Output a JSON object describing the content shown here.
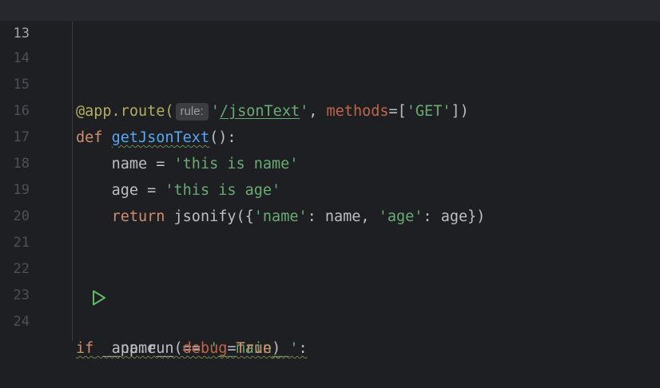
{
  "editor": {
    "lines": [
      {
        "number": "13"
      },
      {
        "number": "14"
      },
      {
        "number": "15",
        "decorator": "@app.route(",
        "hint": "rule:",
        "route": "'/jsonText'",
        "sep": ", ",
        "kwarg": "methods",
        "eq": "=",
        "lb": "[",
        "method": "'GET'",
        "close": "])"
      },
      {
        "number": "16",
        "def": "def ",
        "fname": "getJsonText",
        "rest": "():"
      },
      {
        "number": "17",
        "indent": "    ",
        "var": "name = ",
        "value": "'this is name'"
      },
      {
        "number": "18",
        "indent": "    ",
        "var": "age = ",
        "value": "'this is age'"
      },
      {
        "number": "19",
        "indent": "    ",
        "ret": "return",
        "call": " jsonify({",
        "k1": "'name'",
        "p1": ": name, ",
        "k2": "'age'",
        "p2": ": age})"
      },
      {
        "number": "20"
      },
      {
        "number": "21"
      },
      {
        "number": "22"
      },
      {
        "number": "23",
        "if": "if",
        "cond": " __name__ == ",
        "main": "'__main__'",
        "colon": ":"
      },
      {
        "number": "24",
        "indent": "    ",
        "call": "app.run(",
        "kwarg": "debug",
        "eq": "=",
        "val": "True",
        "close": ")"
      }
    ],
    "run_icon": "run-triangle-icon",
    "colors": {
      "background": "#1e1f22",
      "keyword": "#cf8e6d",
      "function": "#56a8f5",
      "string": "#6aab73",
      "named_arg": "#c0654b",
      "decorator": "#b3ae60",
      "run_icon": "#5fb865"
    }
  }
}
